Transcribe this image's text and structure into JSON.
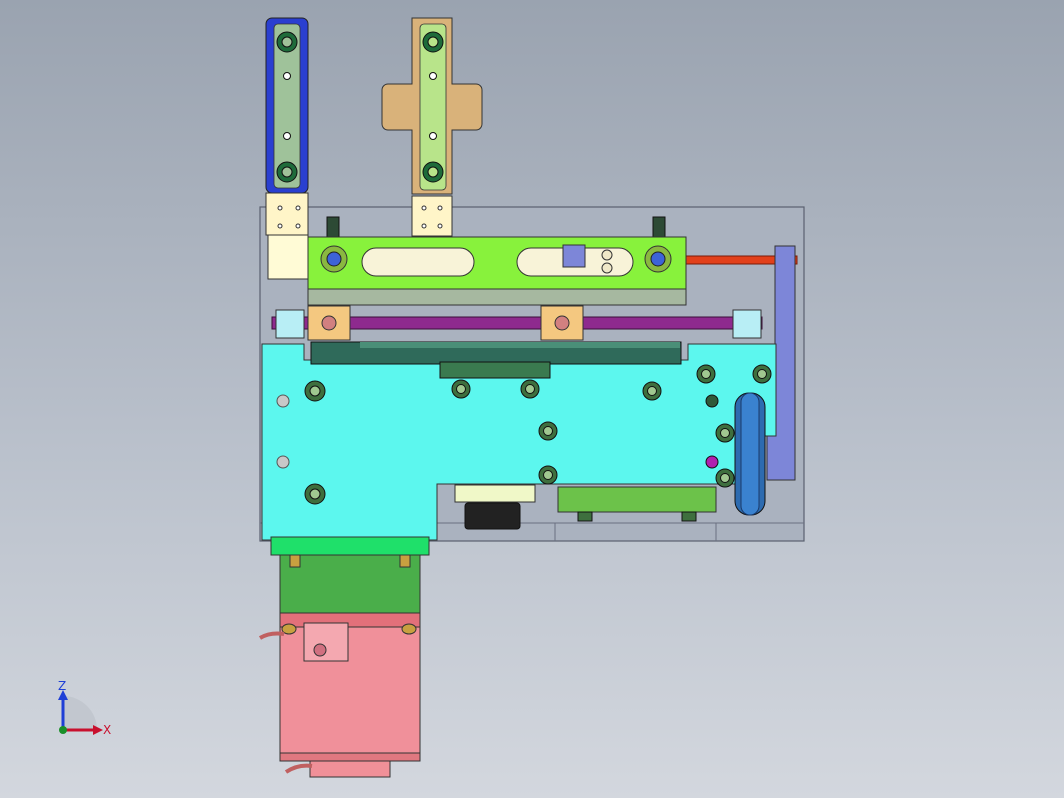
{
  "viewport": {
    "background_top": "#9aa3b0",
    "background_bottom": "#d3d7de"
  },
  "triad": {
    "z_label": "Z",
    "x_label": "X",
    "z_color": "#1f3fd6",
    "x_color": "#c8102e",
    "y_color": "#1a8f2a"
  },
  "colors": {
    "housing": "#aab2bf",
    "base_plate": "#5cf7ee",
    "slider_bar": "#88f23c",
    "bracket_blue": "#2a3fd0",
    "bracket_tan": "#d9b27a",
    "rod": "#8e2a8e",
    "red_rod": "#e2401a",
    "motor_green": "#1fe06a",
    "motor_pink": "#f0909a",
    "side_plate": "#7d86d8"
  }
}
